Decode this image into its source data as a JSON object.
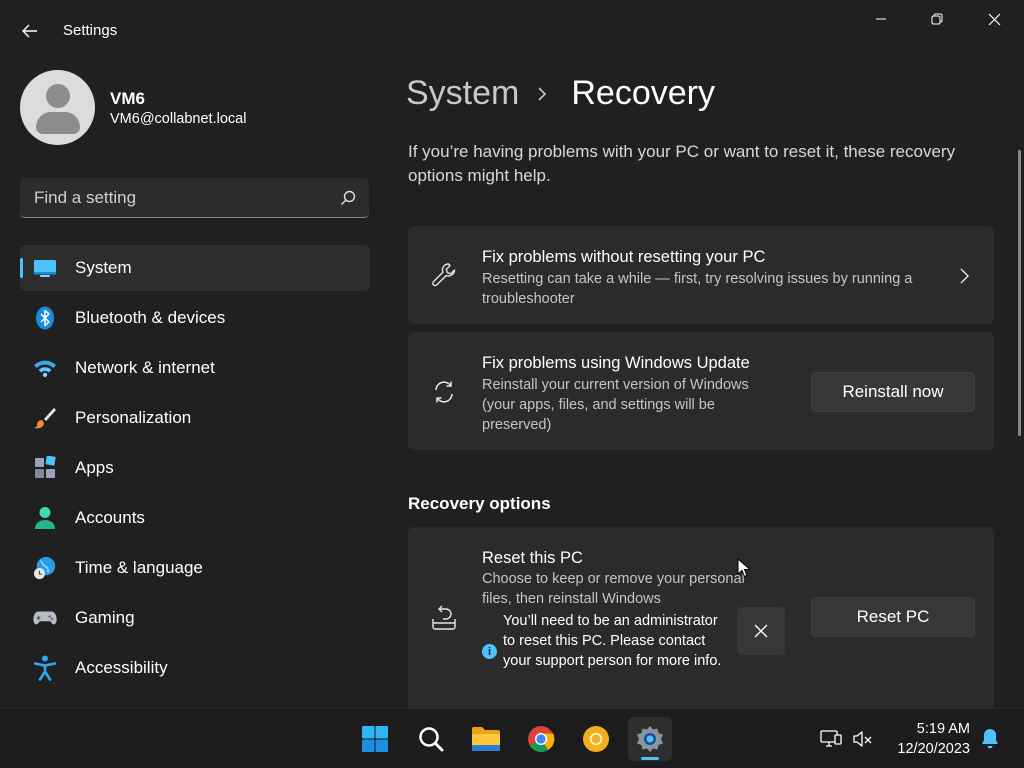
{
  "window": {
    "app_title": "Settings"
  },
  "user": {
    "name": "VM6",
    "email": "VM6@collabnet.local"
  },
  "search": {
    "placeholder": "Find a setting"
  },
  "sidebar": {
    "items": [
      {
        "label": "System",
        "icon": "system-icon",
        "active": true
      },
      {
        "label": "Bluetooth & devices",
        "icon": "bluetooth-icon"
      },
      {
        "label": "Network & internet",
        "icon": "wifi-icon"
      },
      {
        "label": "Personalization",
        "icon": "paintbrush-icon"
      },
      {
        "label": "Apps",
        "icon": "apps-icon"
      },
      {
        "label": "Accounts",
        "icon": "accounts-icon"
      },
      {
        "label": "Time & language",
        "icon": "globe-clock-icon"
      },
      {
        "label": "Gaming",
        "icon": "gamepad-icon"
      },
      {
        "label": "Accessibility",
        "icon": "accessibility-icon"
      }
    ]
  },
  "main": {
    "breadcrumb_parent": "System",
    "breadcrumb_current": "Recovery",
    "intro": "If you’re having problems with your PC or want to reset it, these recovery options might help.",
    "cards": {
      "fix_no_reset": {
        "title": "Fix problems without resetting your PC",
        "desc": "Resetting can take a while — first, try resolving issues by running a troubleshooter"
      },
      "windows_update": {
        "title": "Fix problems using Windows Update",
        "desc": "Reinstall your current version of Windows (your apps, files, and settings will be preserved)",
        "button": "Reinstall now"
      },
      "reset_pc": {
        "title": "Reset this PC",
        "desc": "Choose to keep or remove your personal files, then reinstall Windows",
        "button": "Reset PC",
        "info_message": "You’ll need to be an administrator to reset this PC. Please contact your support person for more info."
      }
    },
    "section_title": "Recovery options"
  },
  "taskbar": {
    "time": "5:19 AM",
    "date": "12/20/2023",
    "apps": [
      "start-icon",
      "search-icon",
      "file-explorer-icon",
      "chrome-icon",
      "chrome-canary-icon",
      "settings-icon"
    ]
  },
  "colors": {
    "accent": "#4cc2ff",
    "background": "#202020",
    "card": "#2b2b2b"
  }
}
